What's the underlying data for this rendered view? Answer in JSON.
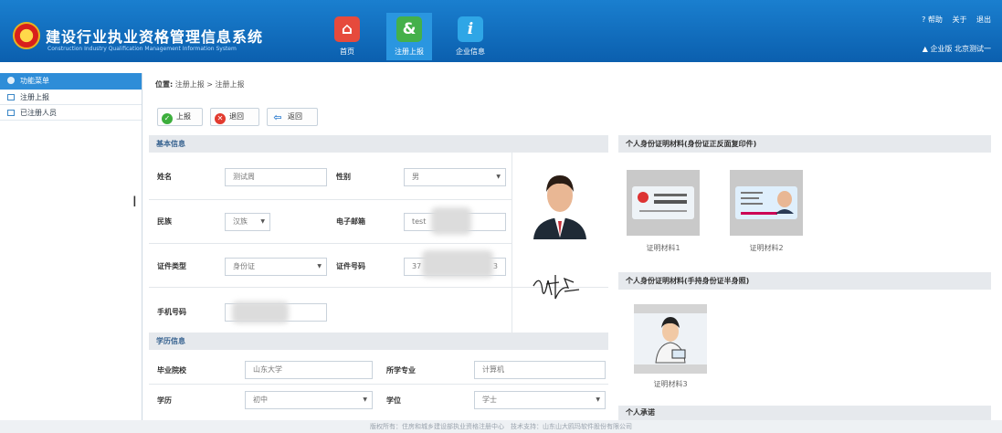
{
  "header": {
    "title": "建设行业执业资格管理信息系统",
    "subtitle": "Construction Industry Qualification Management Information System",
    "nav": [
      {
        "label": "首页",
        "icon": "home-icon"
      },
      {
        "label": "注册上报",
        "icon": "register-icon"
      },
      {
        "label": "企业信息",
        "icon": "info-icon"
      }
    ],
    "links": {
      "help": "帮助",
      "about": "关于",
      "logout": "退出"
    },
    "user": "企业版 北京测试一"
  },
  "sidebar": {
    "title": "功能菜单",
    "items": [
      {
        "label": "注册上报"
      },
      {
        "label": "已注册人员"
      }
    ]
  },
  "breadcrumb": {
    "prefix": "位置:",
    "path": "注册上报 > 注册上报"
  },
  "toolbar": {
    "submit": "上报",
    "back1": "退回",
    "back2": "返回"
  },
  "basic": {
    "title": "基本信息",
    "name_label": "姓名",
    "name_value": "测试周",
    "gender_label": "性别",
    "gender_value": "男",
    "ethnic_label": "民族",
    "ethnic_value": "汉族",
    "email_label": "电子邮箱",
    "email_value": "test",
    "idtype_label": "证件类型",
    "idtype_value": "身份证",
    "idno_label": "证件号码",
    "idno_value": "37",
    "idno_tail": "3",
    "phone_label": "手机号码"
  },
  "edu": {
    "title": "学历信息",
    "school_label": "毕业院校",
    "school_value": "山东大学",
    "major_label": "所学专业",
    "major_value": "计算机",
    "degree_label": "学历",
    "degree_value": "初中",
    "xuewei_label": "学位",
    "xuewei_value": "学士"
  },
  "right": {
    "id_title": "个人身份证明材料(身份证正反面复印件)",
    "cap1": "证明材料1",
    "cap2": "证明材料2",
    "hold_title": "个人身份证明材料(手持身份证半身照)",
    "cap3": "证明材料3",
    "more_title": "个人承诺"
  },
  "footer": "版权所有：住房和城乡建设部执业资格注册中心　技术支持：山东山大鸥玛软件股份有限公司",
  "colors": {
    "header": "#0b5fae",
    "accent": "#2e8dd8",
    "section_bar": "#e6e9ed"
  }
}
